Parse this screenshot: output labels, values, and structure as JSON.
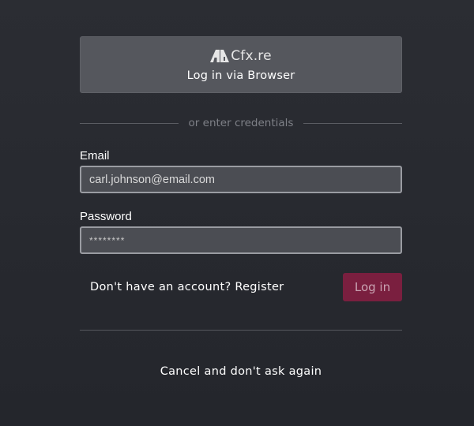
{
  "browser_login": {
    "brand_name": "Cfx.re",
    "label": "Log in via Browser",
    "logo_icon": "cfx-logo-icon"
  },
  "divider": {
    "text": "or enter credentials"
  },
  "email": {
    "label": "Email",
    "value": "carl.johnson@email.com"
  },
  "password": {
    "label": "Password",
    "value": "********"
  },
  "register": {
    "text": "Don't have an account? Register"
  },
  "login": {
    "label": "Log in"
  },
  "cancel": {
    "text": "Cancel and don't ask again"
  },
  "colors": {
    "background": "#2b2d33",
    "browser_button": "#55575d",
    "login_button": "#7a1f3f",
    "input_border": "#9a9ca2"
  }
}
